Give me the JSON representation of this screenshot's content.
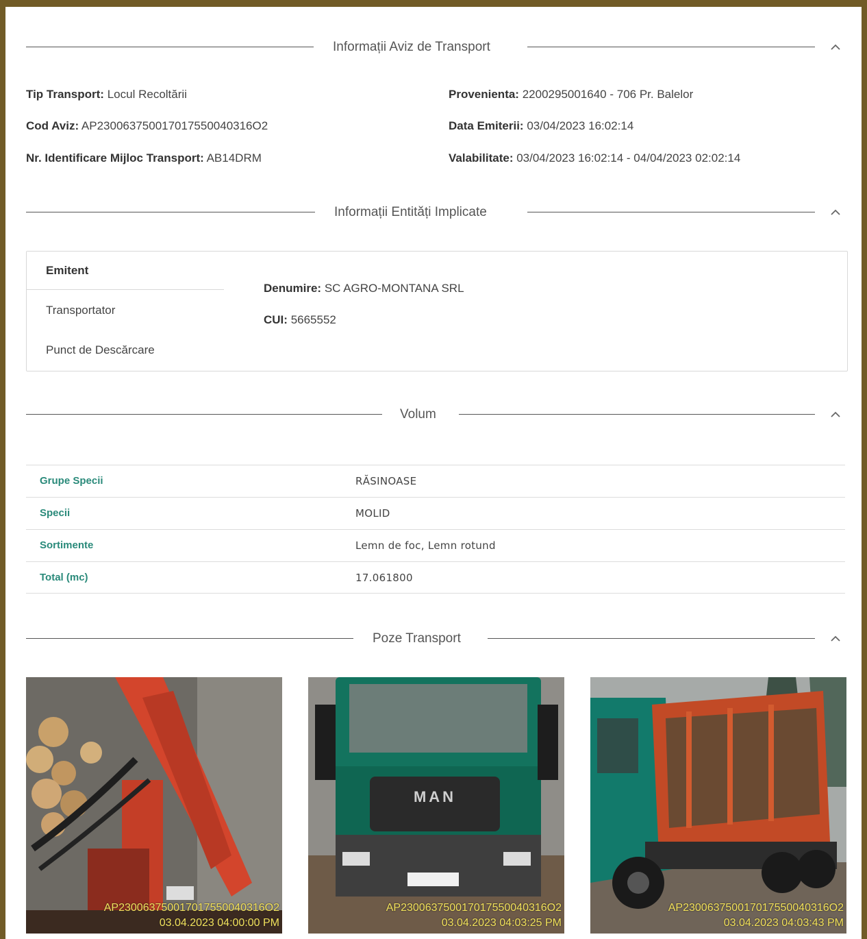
{
  "sections": {
    "aviz": {
      "title": "Informații Aviz de Transport"
    },
    "entitati": {
      "title": "Informații Entități Implicate"
    },
    "volum": {
      "title": "Volum"
    },
    "poze": {
      "title": "Poze Transport"
    }
  },
  "aviz": {
    "tip_transport": {
      "label": "Tip Transport:",
      "value": "Locul Recoltării"
    },
    "cod_aviz": {
      "label": "Cod Aviz:",
      "value": "AP230063750017017550040316O2"
    },
    "nr_identificare": {
      "label": "Nr. Identificare Mijloc Transport:",
      "value": "AB14DRM"
    },
    "provenienta": {
      "label": "Provenienta:",
      "value": "2200295001640 - 706 Pr. Balelor"
    },
    "data_emiterii": {
      "label": "Data Emiterii:",
      "value": "03/04/2023 16:02:14"
    },
    "valabilitate": {
      "label": "Valabilitate:",
      "value": "03/04/2023 16:02:14 - 04/04/2023 02:02:14"
    }
  },
  "entitati": {
    "tabs": [
      "Emitent",
      "Transportator",
      "Punct de Descărcare"
    ],
    "active_tab": "Emitent",
    "denumire": {
      "label": "Denumire:",
      "value": "SC AGRO-MONTANA SRL"
    },
    "cui": {
      "label": "CUI:",
      "value": "5665552"
    }
  },
  "volum": {
    "rows": [
      {
        "label": "Grupe Specii",
        "value": "RĂSINOASE"
      },
      {
        "label": "Specii",
        "value": "MOLID"
      },
      {
        "label": "Sortimente",
        "value": "Lemn de foc, Lemn rotund"
      },
      {
        "label": "Total (mc)",
        "value": "17.061800"
      }
    ]
  },
  "poze": {
    "photos": [
      {
        "code": "AP230063750017017550040316O2",
        "timestamp": "03.04.2023 04:00:00 PM"
      },
      {
        "code": "AP230063750017017550040316O2",
        "timestamp": "03.04.2023 04:03:25 PM"
      },
      {
        "code": "AP230063750017017550040316O2",
        "timestamp": "03.04.2023 04:03:43 PM"
      }
    ]
  },
  "colors": {
    "frame": "#715b27",
    "accent_teal": "#2a8a7a",
    "stamp_yellow": "#f2e05a"
  }
}
